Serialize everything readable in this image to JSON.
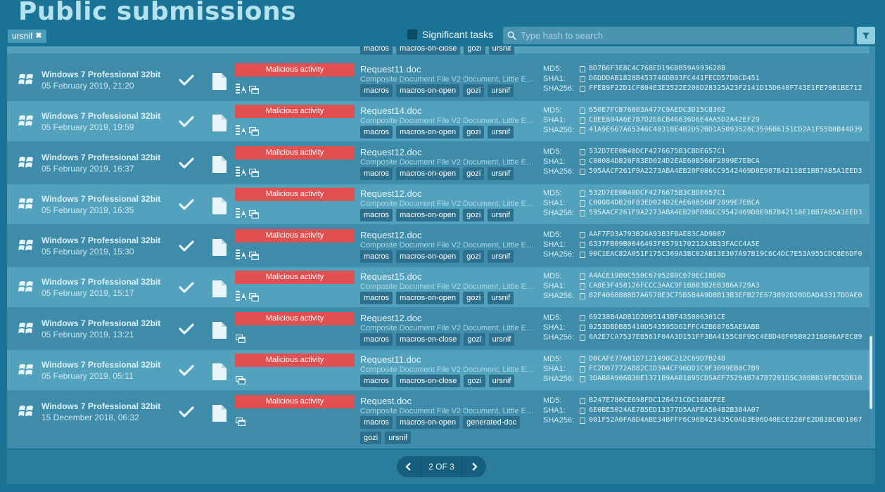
{
  "page": {
    "title": "Public submissions"
  },
  "filter_tag": {
    "label": "ursnif",
    "remove": "✖"
  },
  "significant": {
    "label": "Significant tasks",
    "checked": false
  },
  "search": {
    "placeholder": "Type hash to search",
    "value": ""
  },
  "pagination": {
    "label": "2 OF 3"
  },
  "colors": {
    "background": "#1a7394",
    "verdict": "#e05050",
    "tag": "#2c708d",
    "accent": "#8fd0e0"
  },
  "partial_row_tags": [
    "macros",
    "macros-on-close",
    "gozi",
    "ursnif"
  ],
  "hash_labels": {
    "md5": "MD5:",
    "sha1": "SHA1:",
    "sha256": "SHA256:"
  },
  "rows": [
    {
      "os": "Windows 7 Professional 32bit",
      "date": "05 February 2019, 21:20",
      "verdict": "Malicious activity",
      "file": "Request11.doc",
      "type": "Composite Document File V2 Document, Little Endian, Os: Windows",
      "tags": [
        "macros",
        "macros-on-open",
        "gozi",
        "ursnif"
      ],
      "md5": "BD7B6F3E8C4C768ED196BB59A993628B",
      "sha1": "D6DDDAB1828B453746DB93FC441FECD57D8CD451",
      "sha256": "FFE89F22D1CF804E3E3522E200D28325A23F2141D15D640F743E1FE79B1BE712",
      "icons": 2
    },
    {
      "os": "Windows 7 Professional 32bit",
      "date": "05 February 2019, 19:59",
      "verdict": "Malicious activity",
      "file": "Request14.doc",
      "type": "Composite Document File V2 Document, Little Endian, Os: Windows",
      "tags": [
        "macros",
        "macros-on-open",
        "gozi",
        "ursnif"
      ],
      "md5": "650E7FCB76003A477C9AEDC3D15C8302",
      "sha1": "CBEE804A6E7B7D2E6CB46636D6E4AA5D2A42EF29",
      "sha256": "41A9E667A65346C4031BE4B2D52BD1A5093528C3596B6151CD2A1F55B8B44D39",
      "icons": 2
    },
    {
      "os": "Windows 7 Professional 32bit",
      "date": "05 February 2019, 16:37",
      "verdict": "Malicious activity",
      "file": "Request12.doc",
      "type": "Composite Document File V2 Document, Little Endian, Os: Windows",
      "tags": [
        "macros",
        "macros-on-open",
        "gozi",
        "ursnif"
      ],
      "md5": "532D7EE0B40DCF4276675B3CBDE657C1",
      "sha1": "C00084DB20F83ED024D2EAE60B560F2899E7EBCA",
      "sha256": "595AACF261F9A2273ABA4EB20F086CC9542469D8E987B42118E1BB7A85A1EED3",
      "icons": 2
    },
    {
      "os": "Windows 7 Professional 32bit",
      "date": "05 February 2019, 16:35",
      "verdict": "Malicious activity",
      "file": "Request12.doc",
      "type": "Composite Document File V2 Document, Little Endian, Os: Windows",
      "tags": [
        "macros",
        "macros-on-open",
        "gozi",
        "ursnif"
      ],
      "md5": "532D7EE0B40DCF4276675B3CBDE657C1",
      "sha1": "C00084DB20F83ED024D2EAE60B560F2899E7EBCA",
      "sha256": "595AACF261F9A2273ABA4EB20F086CC9542469D8E987B42118E1BB7A85A1EED3",
      "icons": 2
    },
    {
      "os": "Windows 7 Professional 32bit",
      "date": "05 February 2019, 15:30",
      "verdict": "Malicious activity",
      "file": "Request12.doc",
      "type": "Composite Document File V2 Document, Little Endian, Os: Windows",
      "tags": [
        "macros",
        "macros-on-open",
        "gozi",
        "ursnif"
      ],
      "md5": "AAF7FD3A793B26A93B3FBAE83CAD9087",
      "sha1": "6337FB09B0046493F0579170212A3B33FACC4A5E",
      "sha256": "90C1EAC82A051F175C369A3BC02AB13E307A97B19C6C4DC7E53A955CDC8E6DF0",
      "icons": 2
    },
    {
      "os": "Windows 7 Professional 32bit",
      "date": "05 February 2019, 15:17",
      "verdict": "Malicious activity",
      "file": "Request15.doc",
      "type": "Composite Document File V2 Document, Little Endian, Os: Windows",
      "tags": [
        "macros",
        "macros-on-open",
        "gozi",
        "ursnif"
      ],
      "md5": "A4ACE19B0C550C6705280C679EC18D0D",
      "sha1": "CA8E3F458126FCCC3AAC9F1BBB3B2EB386A729A3",
      "sha256": "82F4068888B7A6578E3C75B5B4A9D8B13B3EFB27E673892D20DDAD43317DDAE0",
      "icons": 2
    },
    {
      "os": "Windows 7 Professional 32bit",
      "date": "05 February 2019, 13:21",
      "verdict": "Malicious activity",
      "file": "Request12.doc",
      "type": "Composite Document File V2 Document, Little Endian, Os: Windows",
      "tags": [
        "macros",
        "macros-on-close",
        "gozi",
        "ursnif"
      ],
      "md5": "69238B4ADB1D2D95143BF435006301CE",
      "sha1": "0253DBDB85410D543595D61FFC42B68765AE9ABB",
      "sha256": "6A2E7CA7537E8561F04A3D151FF3BA4155C8F95C4EBD48F05B02316B06AFEC89",
      "icons": 1
    },
    {
      "os": "Windows 7 Professional 32bit",
      "date": "05 February 2019, 05:11",
      "verdict": "Malicious activity",
      "file": "Request11.doc",
      "type": "Composite Document File V2 Document, Little Endian, Os: Windows",
      "tags": [
        "macros",
        "macros-on-close",
        "gozi",
        "ursnif"
      ],
      "md5": "D0CAFE77681D7121490C212C69D7B248",
      "sha1": "FC2D07772AB82C1D3A4CF90DD1C9F3099EB0C7B9",
      "sha256": "3DAB8A906B30E1371B9AAB1895CD5AEF75294B747B7291D5C308BB19FBC5DB10",
      "icons": 1
    },
    {
      "os": "Windows 7 Professional 32bit",
      "date": "15 December 2018, 06:32",
      "verdict": "Malicious activity",
      "file": "Request.doc",
      "type": "Composite Document File V2 Document, Little Endian, Os: Windows",
      "tags": [
        "macros",
        "macros-on-open",
        "generated-doc",
        "gozi",
        "ursnif"
      ],
      "md5": "B247E780CE698FDC126471CDC16BCFEE",
      "sha1": "6E0BE5024AE7B5ED13377D5AAFEA504B2B384A07",
      "sha256": "001F52A0FA8D4ABE34BFFF6C96B423435C0AD3E06D40ECE228FE2DB3BC0D1067",
      "icons": 1
    }
  ]
}
